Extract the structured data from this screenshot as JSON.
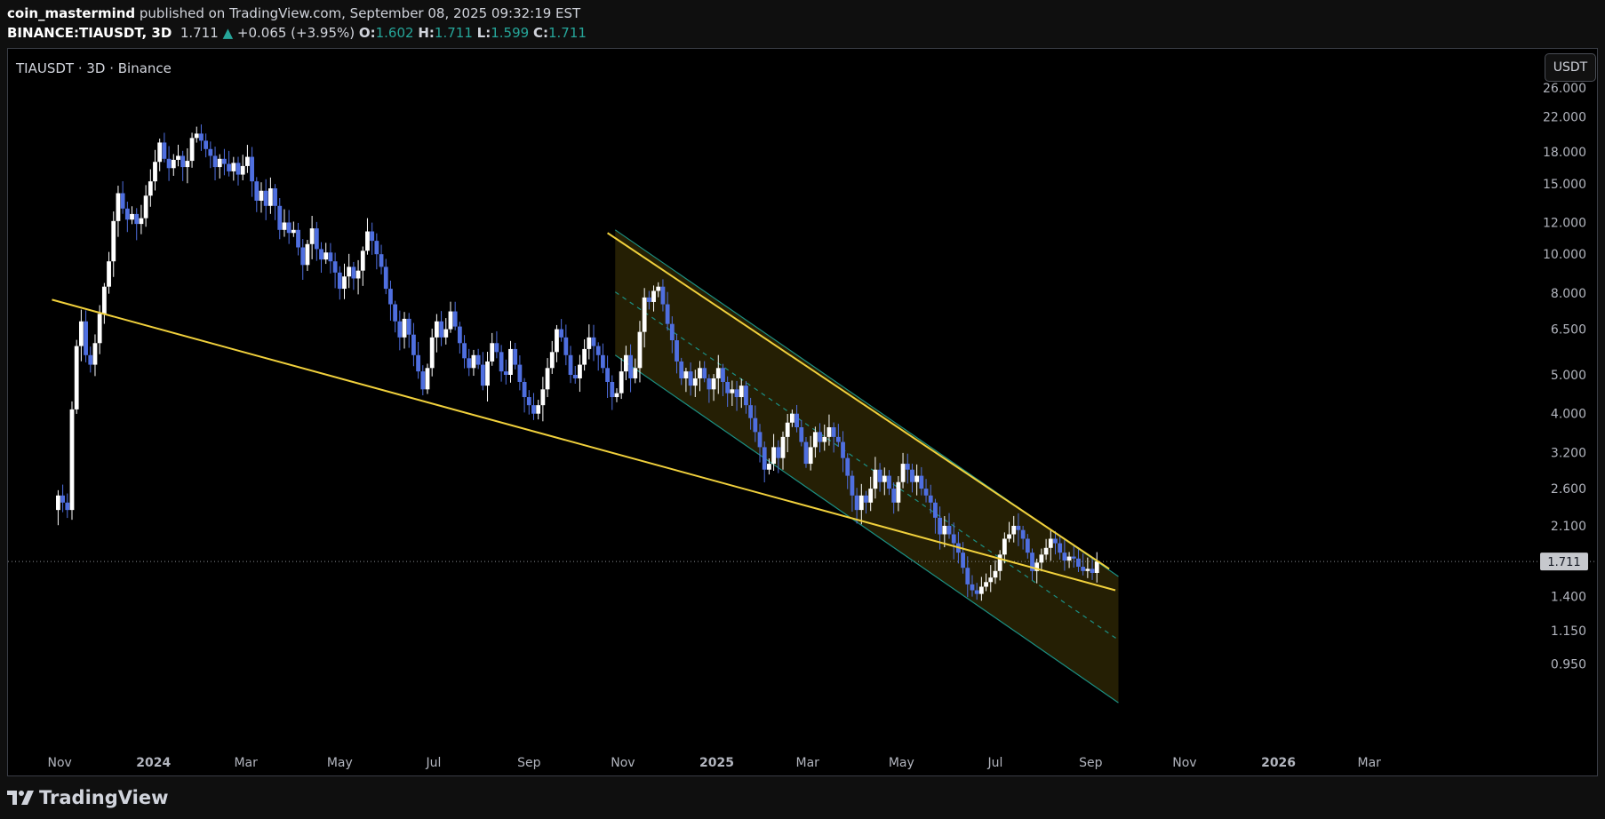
{
  "header": {
    "author": "coin_mastermind",
    "published_text": " published on TradingView.com, September 08, 2025 09:32:19 EST",
    "symbol": "BINANCE:TIAUSDT, 3D",
    "last": "1.711",
    "change": "+0.065 (+3.95%)",
    "o_label": "O:",
    "o": "1.602",
    "h_label": "H:",
    "h": "1.711",
    "l_label": "L:",
    "l": "1.599",
    "c_label": "C:",
    "c": "1.711",
    "up_arrow": "▲"
  },
  "chart_label": "TIAUSDT · 3D · Binance",
  "currency_button": "USDT",
  "footer": {
    "brand": "TradingView",
    "logo_icon": "tradingview-logo-icon"
  },
  "colors": {
    "background": "#000000",
    "bull_candle": "#ffffff",
    "bear_candle": "#4f6fe0",
    "trendline": "#f0d03c",
    "channel_line": "#1b8f83",
    "channel_fill": "#2b2405",
    "text": "#d1d4dc",
    "accent_up": "#26a69a"
  },
  "chart_data": {
    "type": "candlestick",
    "title": "TIAUSDT · 3D · Binance",
    "y_scale": "log",
    "y_ticks": [
      26.0,
      22.0,
      18.0,
      15.0,
      12.0,
      10.0,
      8.0,
      6.5,
      5.0,
      4.0,
      3.2,
      2.6,
      2.1,
      1.4,
      1.15,
      0.95
    ],
    "y_tick_labels": [
      "26.000",
      "22.000",
      "18.000",
      "15.000",
      "12.000",
      "10.000",
      "8.000",
      "6.500",
      "5.000",
      "4.000",
      "3.200",
      "2.600",
      "2.100",
      "1.400",
      "1.150",
      "0.950"
    ],
    "x_ticks": [
      "2023-11-01",
      "2024-01-01",
      "2024-03-01",
      "2024-05-01",
      "2024-07-01",
      "2024-09-01",
      "2024-11-01",
      "2025-01-01",
      "2025-03-01",
      "2025-05-01",
      "2025-07-01",
      "2025-09-01",
      "2025-11-01",
      "2026-01-01",
      "2026-03-01"
    ],
    "x_tick_labels": [
      "Nov",
      "2024",
      "Mar",
      "May",
      "Jul",
      "Sep",
      "Nov",
      "2025",
      "Mar",
      "May",
      "Jul",
      "Sep",
      "Nov",
      "2026",
      "Mar"
    ],
    "x_range": [
      "2023-09-29",
      "2026-04-10"
    ],
    "y_range": [
      0.78,
      27.5
    ],
    "last_price": 1.711,
    "last_price_label": "1.711",
    "closes": [
      {
        "d": "2023-10-31",
        "c": 2.5
      },
      {
        "d": "2023-11-03",
        "c": 2.4
      },
      {
        "d": "2023-11-06",
        "c": 2.3
      },
      {
        "d": "2023-11-09",
        "c": 4.1
      },
      {
        "d": "2023-11-12",
        "c": 5.9
      },
      {
        "d": "2023-11-15",
        "c": 6.8
      },
      {
        "d": "2023-11-18",
        "c": 5.6
      },
      {
        "d": "2023-11-21",
        "c": 5.3
      },
      {
        "d": "2023-11-24",
        "c": 6.0
      },
      {
        "d": "2023-11-27",
        "c": 7.1
      },
      {
        "d": "2023-11-30",
        "c": 8.3
      },
      {
        "d": "2023-12-03",
        "c": 9.6
      },
      {
        "d": "2023-12-06",
        "c": 12.1
      },
      {
        "d": "2023-12-09",
        "c": 14.2
      },
      {
        "d": "2023-12-12",
        "c": 13.0
      },
      {
        "d": "2023-12-15",
        "c": 12.2
      },
      {
        "d": "2023-12-18",
        "c": 12.6
      },
      {
        "d": "2023-12-21",
        "c": 11.9
      },
      {
        "d": "2023-12-24",
        "c": 12.3
      },
      {
        "d": "2023-12-27",
        "c": 14.0
      },
      {
        "d": "2023-12-30",
        "c": 15.2
      },
      {
        "d": "2024-01-02",
        "c": 17.0
      },
      {
        "d": "2024-01-05",
        "c": 19.0
      },
      {
        "d": "2024-01-08",
        "c": 17.3
      },
      {
        "d": "2024-01-11",
        "c": 16.4
      },
      {
        "d": "2024-01-14",
        "c": 17.2
      },
      {
        "d": "2024-01-17",
        "c": 17.6
      },
      {
        "d": "2024-01-20",
        "c": 16.5
      },
      {
        "d": "2024-01-23",
        "c": 17.1
      },
      {
        "d": "2024-01-26",
        "c": 19.5
      },
      {
        "d": "2024-01-29",
        "c": 20.0
      },
      {
        "d": "2024-02-01",
        "c": 19.2
      },
      {
        "d": "2024-02-04",
        "c": 18.3
      },
      {
        "d": "2024-02-07",
        "c": 17.6
      },
      {
        "d": "2024-02-10",
        "c": 16.5
      },
      {
        "d": "2024-02-13",
        "c": 17.3
      },
      {
        "d": "2024-02-16",
        "c": 16.8
      },
      {
        "d": "2024-02-19",
        "c": 16.1
      },
      {
        "d": "2024-02-22",
        "c": 16.9
      },
      {
        "d": "2024-02-25",
        "c": 15.8
      },
      {
        "d": "2024-02-28",
        "c": 16.6
      },
      {
        "d": "2024-03-02",
        "c": 17.5
      },
      {
        "d": "2024-03-05",
        "c": 15.2
      },
      {
        "d": "2024-03-08",
        "c": 13.6
      },
      {
        "d": "2024-03-11",
        "c": 14.4
      },
      {
        "d": "2024-03-14",
        "c": 13.2
      },
      {
        "d": "2024-03-17",
        "c": 14.6
      },
      {
        "d": "2024-03-20",
        "c": 13.2
      },
      {
        "d": "2024-03-23",
        "c": 11.5
      },
      {
        "d": "2024-03-26",
        "c": 12.0
      },
      {
        "d": "2024-03-29",
        "c": 11.3
      },
      {
        "d": "2024-04-01",
        "c": 11.5
      },
      {
        "d": "2024-04-04",
        "c": 10.4
      },
      {
        "d": "2024-04-07",
        "c": 9.4
      },
      {
        "d": "2024-04-10",
        "c": 10.6
      },
      {
        "d": "2024-04-13",
        "c": 11.6
      },
      {
        "d": "2024-04-16",
        "c": 10.3
      },
      {
        "d": "2024-04-19",
        "c": 9.7
      },
      {
        "d": "2024-04-22",
        "c": 10.1
      },
      {
        "d": "2024-04-25",
        "c": 9.6
      },
      {
        "d": "2024-04-28",
        "c": 9.0
      },
      {
        "d": "2024-05-01",
        "c": 8.2
      },
      {
        "d": "2024-05-04",
        "c": 8.8
      },
      {
        "d": "2024-05-07",
        "c": 9.3
      },
      {
        "d": "2024-05-10",
        "c": 8.7
      },
      {
        "d": "2024-05-13",
        "c": 9.1
      },
      {
        "d": "2024-05-16",
        "c": 10.2
      },
      {
        "d": "2024-05-19",
        "c": 11.4
      },
      {
        "d": "2024-05-22",
        "c": 10.8
      },
      {
        "d": "2024-05-25",
        "c": 10.0
      },
      {
        "d": "2024-05-28",
        "c": 9.3
      },
      {
        "d": "2024-05-31",
        "c": 8.2
      },
      {
        "d": "2024-06-03",
        "c": 7.5
      },
      {
        "d": "2024-06-06",
        "c": 6.8
      },
      {
        "d": "2024-06-09",
        "c": 6.2
      },
      {
        "d": "2024-06-12",
        "c": 6.9
      },
      {
        "d": "2024-06-15",
        "c": 6.3
      },
      {
        "d": "2024-06-18",
        "c": 5.6
      },
      {
        "d": "2024-06-21",
        "c": 5.1
      },
      {
        "d": "2024-06-24",
        "c": 4.6
      },
      {
        "d": "2024-06-27",
        "c": 5.2
      },
      {
        "d": "2024-06-30",
        "c": 6.2
      },
      {
        "d": "2024-07-03",
        "c": 6.8
      },
      {
        "d": "2024-07-06",
        "c": 6.2
      },
      {
        "d": "2024-07-09",
        "c": 6.5
      },
      {
        "d": "2024-07-12",
        "c": 7.2
      },
      {
        "d": "2024-07-15",
        "c": 6.6
      },
      {
        "d": "2024-07-18",
        "c": 6.0
      },
      {
        "d": "2024-07-21",
        "c": 5.5
      },
      {
        "d": "2024-07-24",
        "c": 5.2
      },
      {
        "d": "2024-07-27",
        "c": 5.6
      },
      {
        "d": "2024-07-30",
        "c": 5.3
      },
      {
        "d": "2024-08-02",
        "c": 4.7
      },
      {
        "d": "2024-08-05",
        "c": 5.4
      },
      {
        "d": "2024-08-08",
        "c": 6.0
      },
      {
        "d": "2024-08-11",
        "c": 5.7
      },
      {
        "d": "2024-08-14",
        "c": 5.1
      },
      {
        "d": "2024-08-17",
        "c": 5.0
      },
      {
        "d": "2024-08-20",
        "c": 5.8
      },
      {
        "d": "2024-08-23",
        "c": 5.3
      },
      {
        "d": "2024-08-26",
        "c": 4.8
      },
      {
        "d": "2024-08-29",
        "c": 4.4
      },
      {
        "d": "2024-09-01",
        "c": 4.2
      },
      {
        "d": "2024-09-04",
        "c": 4.0
      },
      {
        "d": "2024-09-07",
        "c": 4.2
      },
      {
        "d": "2024-09-10",
        "c": 4.6
      },
      {
        "d": "2024-09-13",
        "c": 5.2
      },
      {
        "d": "2024-09-16",
        "c": 5.7
      },
      {
        "d": "2024-09-19",
        "c": 6.5
      },
      {
        "d": "2024-09-22",
        "c": 6.2
      },
      {
        "d": "2024-09-25",
        "c": 5.6
      },
      {
        "d": "2024-09-28",
        "c": 5.0
      },
      {
        "d": "2024-10-01",
        "c": 4.9
      },
      {
        "d": "2024-10-04",
        "c": 5.3
      },
      {
        "d": "2024-10-07",
        "c": 5.8
      },
      {
        "d": "2024-10-10",
        "c": 6.2
      },
      {
        "d": "2024-10-13",
        "c": 5.9
      },
      {
        "d": "2024-10-16",
        "c": 5.6
      },
      {
        "d": "2024-10-19",
        "c": 5.2
      },
      {
        "d": "2024-10-22",
        "c": 4.8
      },
      {
        "d": "2024-10-25",
        "c": 4.4
      },
      {
        "d": "2024-10-28",
        "c": 4.5
      },
      {
        "d": "2024-10-31",
        "c": 5.1
      },
      {
        "d": "2024-11-03",
        "c": 5.6
      },
      {
        "d": "2024-11-06",
        "c": 4.9
      },
      {
        "d": "2024-11-09",
        "c": 5.2
      },
      {
        "d": "2024-11-12",
        "c": 6.4
      },
      {
        "d": "2024-11-15",
        "c": 7.8
      },
      {
        "d": "2024-11-18",
        "c": 7.6
      },
      {
        "d": "2024-11-21",
        "c": 8.1
      },
      {
        "d": "2024-11-24",
        "c": 8.3
      },
      {
        "d": "2024-11-27",
        "c": 7.5
      },
      {
        "d": "2024-11-30",
        "c": 6.7
      },
      {
        "d": "2024-12-03",
        "c": 6.1
      },
      {
        "d": "2024-12-06",
        "c": 5.4
      },
      {
        "d": "2024-12-09",
        "c": 4.9
      },
      {
        "d": "2024-12-12",
        "c": 5.1
      },
      {
        "d": "2024-12-15",
        "c": 4.7
      },
      {
        "d": "2024-12-18",
        "c": 4.9
      },
      {
        "d": "2024-12-21",
        "c": 5.2
      },
      {
        "d": "2024-12-24",
        "c": 4.9
      },
      {
        "d": "2024-12-27",
        "c": 4.6
      },
      {
        "d": "2024-12-30",
        "c": 4.9
      },
      {
        "d": "2025-01-02",
        "c": 5.2
      },
      {
        "d": "2025-01-05",
        "c": 4.8
      },
      {
        "d": "2025-01-08",
        "c": 4.5
      },
      {
        "d": "2025-01-11",
        "c": 4.6
      },
      {
        "d": "2025-01-14",
        "c": 4.4
      },
      {
        "d": "2025-01-17",
        "c": 4.7
      },
      {
        "d": "2025-01-20",
        "c": 4.2
      },
      {
        "d": "2025-01-23",
        "c": 3.9
      },
      {
        "d": "2025-01-26",
        "c": 3.6
      },
      {
        "d": "2025-01-29",
        "c": 3.3
      },
      {
        "d": "2025-02-01",
        "c": 2.9
      },
      {
        "d": "2025-02-04",
        "c": 3.0
      },
      {
        "d": "2025-02-07",
        "c": 3.3
      },
      {
        "d": "2025-02-10",
        "c": 3.1
      },
      {
        "d": "2025-02-13",
        "c": 3.5
      },
      {
        "d": "2025-02-16",
        "c": 3.8
      },
      {
        "d": "2025-02-19",
        "c": 4.0
      },
      {
        "d": "2025-02-22",
        "c": 3.7
      },
      {
        "d": "2025-02-25",
        "c": 3.4
      },
      {
        "d": "2025-02-28",
        "c": 3.0
      },
      {
        "d": "2025-03-03",
        "c": 3.3
      },
      {
        "d": "2025-03-06",
        "c": 3.6
      },
      {
        "d": "2025-03-09",
        "c": 3.4
      },
      {
        "d": "2025-03-12",
        "c": 3.5
      },
      {
        "d": "2025-03-15",
        "c": 3.7
      },
      {
        "d": "2025-03-18",
        "c": 3.5
      },
      {
        "d": "2025-03-21",
        "c": 3.4
      },
      {
        "d": "2025-03-24",
        "c": 3.1
      },
      {
        "d": "2025-03-27",
        "c": 2.8
      },
      {
        "d": "2025-03-30",
        "c": 2.5
      },
      {
        "d": "2025-04-02",
        "c": 2.3
      },
      {
        "d": "2025-04-05",
        "c": 2.5
      },
      {
        "d": "2025-04-08",
        "c": 2.4
      },
      {
        "d": "2025-04-11",
        "c": 2.6
      },
      {
        "d": "2025-04-14",
        "c": 2.9
      },
      {
        "d": "2025-04-17",
        "c": 2.7
      },
      {
        "d": "2025-04-20",
        "c": 2.8
      },
      {
        "d": "2025-04-23",
        "c": 2.6
      },
      {
        "d": "2025-04-26",
        "c": 2.4
      },
      {
        "d": "2025-04-29",
        "c": 2.7
      },
      {
        "d": "2025-05-02",
        "c": 3.0
      },
      {
        "d": "2025-05-05",
        "c": 2.9
      },
      {
        "d": "2025-05-08",
        "c": 2.7
      },
      {
        "d": "2025-05-11",
        "c": 2.8
      },
      {
        "d": "2025-05-14",
        "c": 2.6
      },
      {
        "d": "2025-05-17",
        "c": 2.5
      },
      {
        "d": "2025-05-20",
        "c": 2.4
      },
      {
        "d": "2025-05-23",
        "c": 2.2
      },
      {
        "d": "2025-05-26",
        "c": 2.0
      },
      {
        "d": "2025-05-29",
        "c": 2.1
      },
      {
        "d": "2025-06-01",
        "c": 2.0
      },
      {
        "d": "2025-06-04",
        "c": 1.9
      },
      {
        "d": "2025-06-07",
        "c": 1.8
      },
      {
        "d": "2025-06-10",
        "c": 1.65
      },
      {
        "d": "2025-06-13",
        "c": 1.5
      },
      {
        "d": "2025-06-16",
        "c": 1.45
      },
      {
        "d": "2025-06-19",
        "c": 1.42
      },
      {
        "d": "2025-06-22",
        "c": 1.48
      },
      {
        "d": "2025-06-25",
        "c": 1.52
      },
      {
        "d": "2025-06-28",
        "c": 1.56
      },
      {
        "d": "2025-07-01",
        "c": 1.62
      },
      {
        "d": "2025-07-04",
        "c": 1.78
      },
      {
        "d": "2025-07-07",
        "c": 1.95
      },
      {
        "d": "2025-07-10",
        "c": 2.0
      },
      {
        "d": "2025-07-13",
        "c": 2.1
      },
      {
        "d": "2025-07-16",
        "c": 2.05
      },
      {
        "d": "2025-07-19",
        "c": 1.95
      },
      {
        "d": "2025-07-22",
        "c": 1.8
      },
      {
        "d": "2025-07-25",
        "c": 1.62
      },
      {
        "d": "2025-07-28",
        "c": 1.7
      },
      {
        "d": "2025-07-31",
        "c": 1.78
      },
      {
        "d": "2025-08-03",
        "c": 1.85
      },
      {
        "d": "2025-08-06",
        "c": 1.95
      },
      {
        "d": "2025-08-09",
        "c": 1.9
      },
      {
        "d": "2025-08-12",
        "c": 1.8
      },
      {
        "d": "2025-08-15",
        "c": 1.72
      },
      {
        "d": "2025-08-18",
        "c": 1.76
      },
      {
        "d": "2025-08-21",
        "c": 1.74
      },
      {
        "d": "2025-08-24",
        "c": 1.66
      },
      {
        "d": "2025-08-27",
        "c": 1.62
      },
      {
        "d": "2025-08-30",
        "c": 1.64
      },
      {
        "d": "2025-09-02",
        "c": 1.602
      },
      {
        "d": "2025-09-05",
        "c": 1.711
      }
    ],
    "trendlines": [
      {
        "name": "lower-wedge",
        "from": {
          "d": "2023-10-27",
          "p": 7.7
        },
        "to": {
          "d": "2025-09-17",
          "p": 1.45
        }
      },
      {
        "name": "upper-wedge",
        "from": {
          "d": "2024-10-22",
          "p": 11.3
        },
        "to": {
          "d": "2025-09-13",
          "p": 1.64
        }
      }
    ],
    "channel": {
      "upper": {
        "from": {
          "d": "2024-10-27",
          "p": 11.5
        },
        "to": {
          "d": "2025-09-19",
          "p": 1.57
        }
      },
      "mid": {
        "from": {
          "d": "2024-10-27",
          "p": 8.05
        },
        "to": {
          "d": "2025-09-19",
          "p": 1.09
        }
      },
      "lower": {
        "from": {
          "d": "2024-10-27",
          "p": 5.6
        },
        "to": {
          "d": "2025-09-19",
          "p": 0.76
        }
      }
    }
  }
}
